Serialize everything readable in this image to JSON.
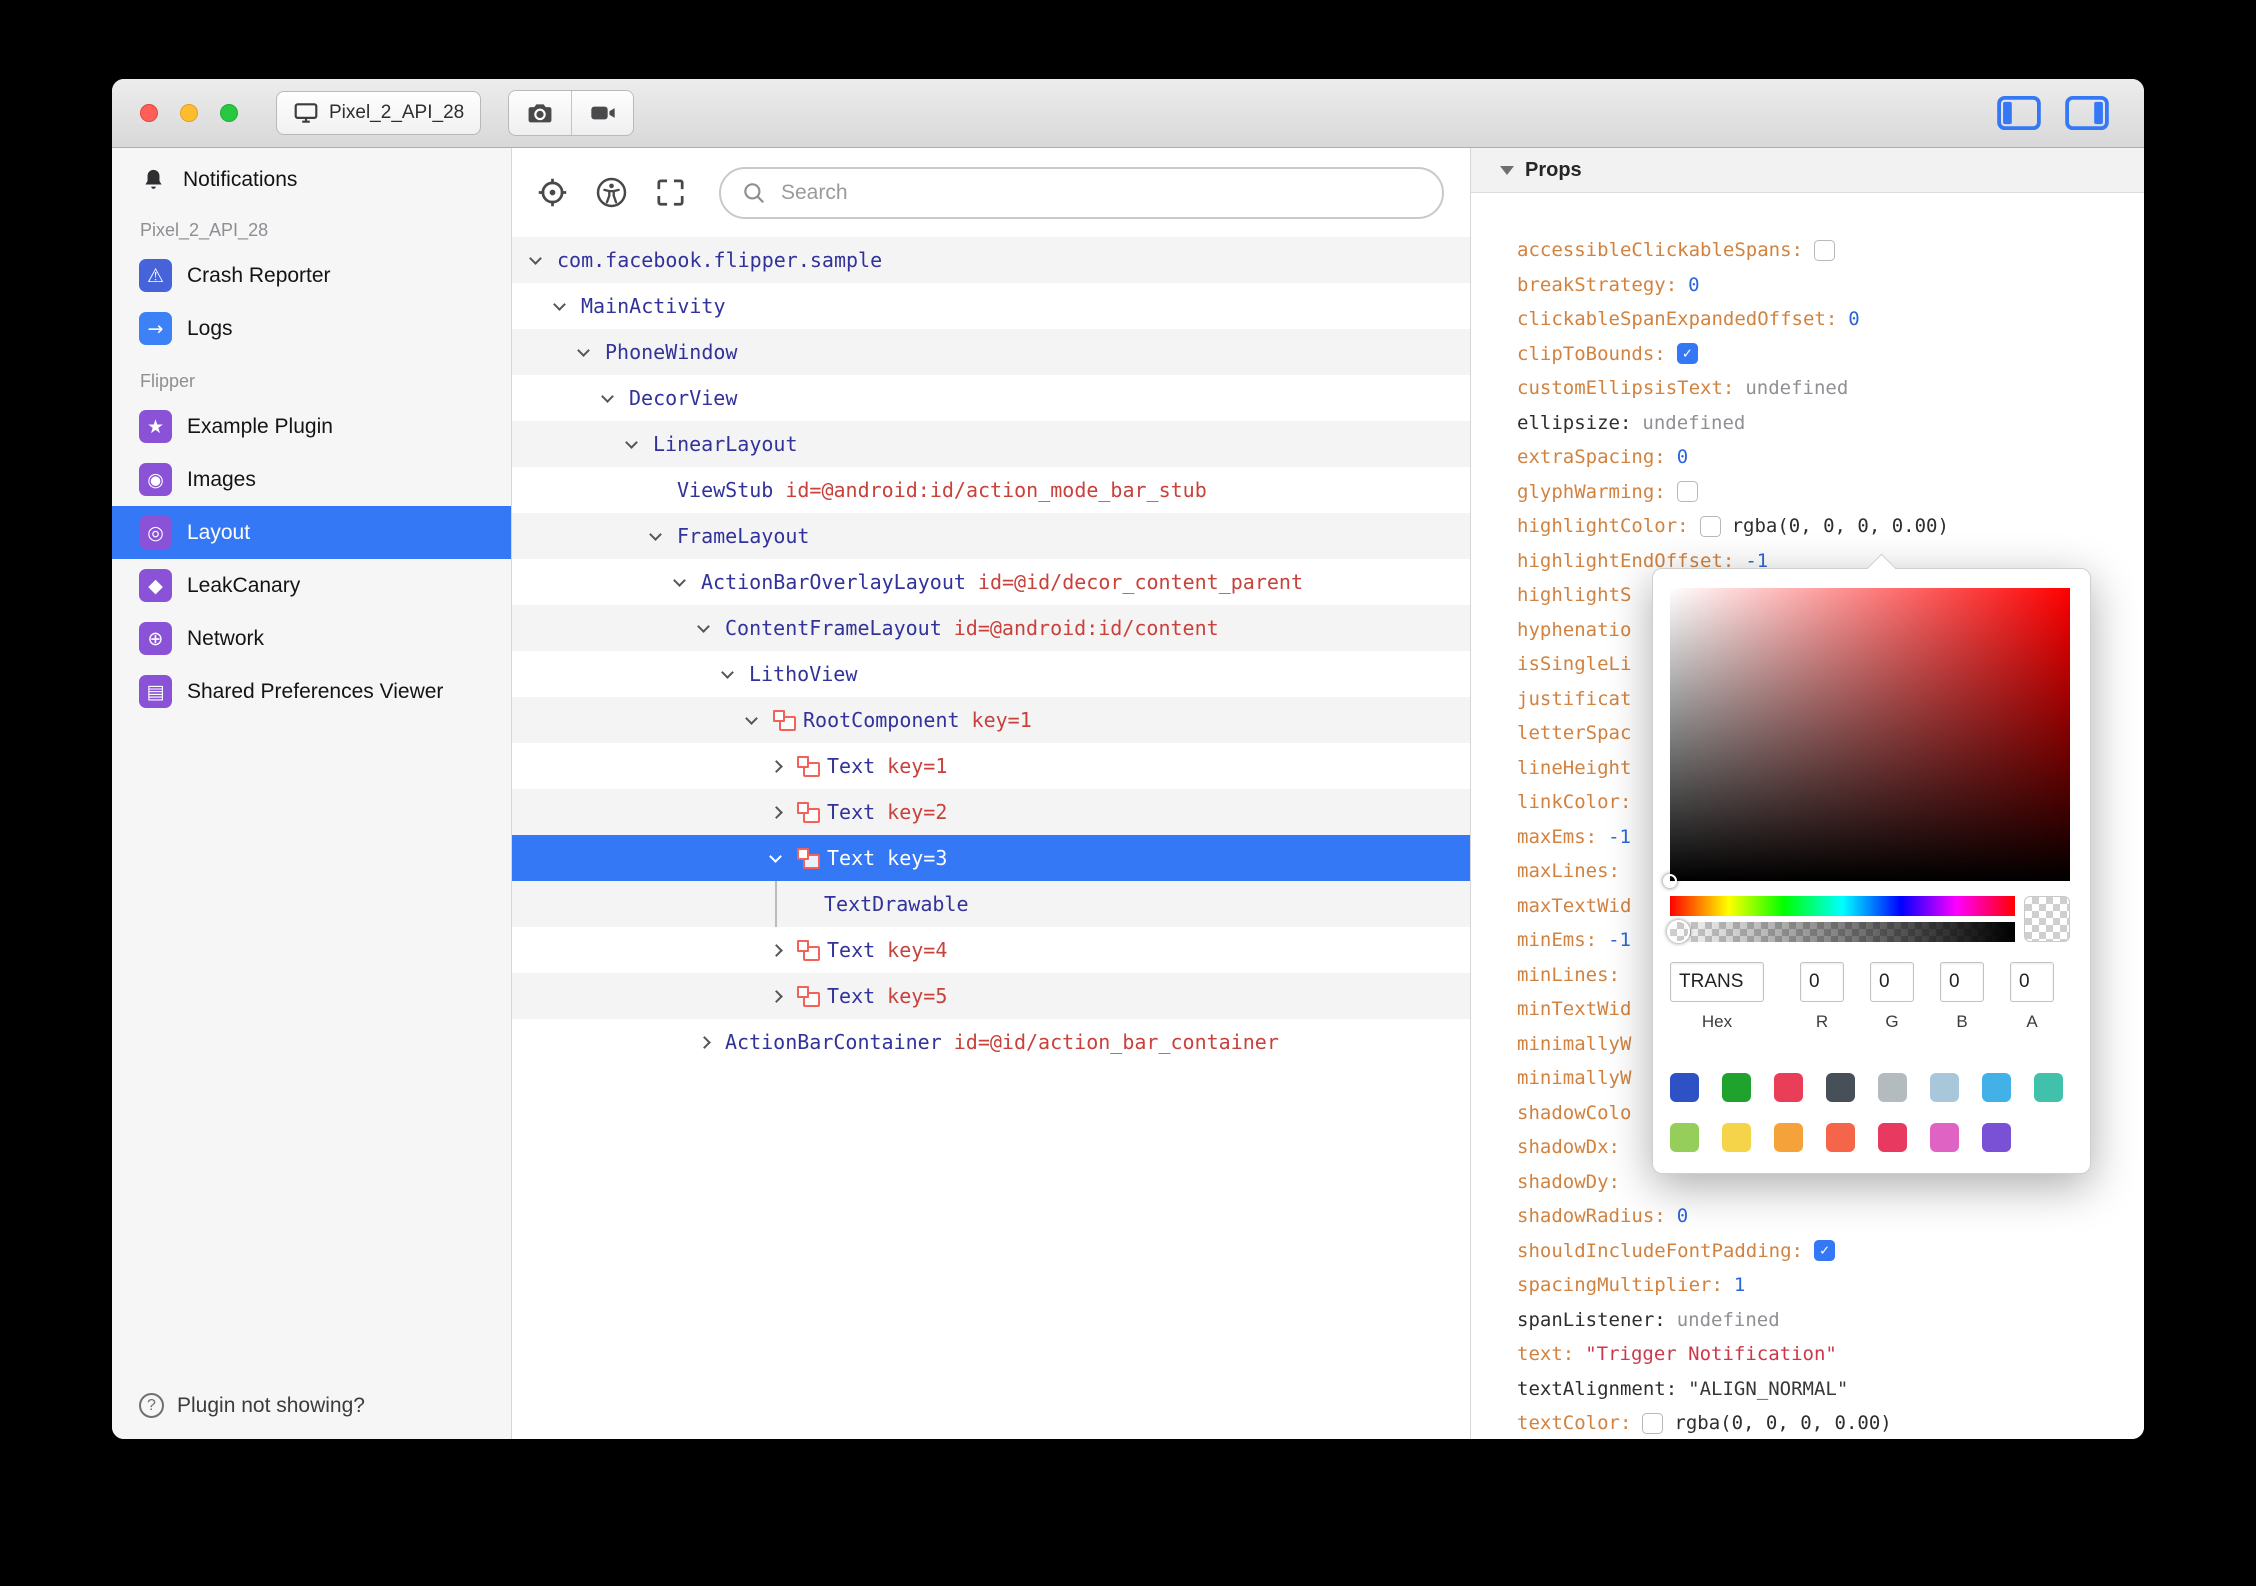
{
  "colors": {
    "selection": "#3478f6",
    "tree_name": "#32329b",
    "tree_attr": "#c8413b",
    "prop_key": "#d1823f",
    "prop_number": "#2b66d9",
    "prop_string": "#cb3849"
  },
  "titlebar": {
    "device_label": "Pixel_2_API_28"
  },
  "sidebar": {
    "notifications_label": "Notifications",
    "sections": [
      {
        "label": "Pixel_2_API_28",
        "items": [
          {
            "label": "Crash Reporter",
            "icon": "crash-reporter-icon",
            "glyph": "⚠",
            "color": "#4663d9"
          },
          {
            "label": "Logs",
            "icon": "logs-icon",
            "glyph": "→",
            "color": "#3c82f6"
          }
        ]
      },
      {
        "label": "Flipper",
        "items": [
          {
            "label": "Example Plugin",
            "icon": "example-plugin-icon",
            "glyph": "★",
            "color": "#8a52d7"
          },
          {
            "label": "Images",
            "icon": "images-icon",
            "glyph": "◉",
            "color": "#8a52d7"
          },
          {
            "label": "Layout",
            "icon": "layout-icon",
            "glyph": "◎",
            "color": "#8a52d7",
            "selected": true
          },
          {
            "label": "LeakCanary",
            "icon": "leakcanary-icon",
            "glyph": "◆",
            "color": "#8a52d7"
          },
          {
            "label": "Network",
            "icon": "network-icon",
            "glyph": "⊕",
            "color": "#8a52d7"
          },
          {
            "label": "Shared Preferences Viewer",
            "icon": "shared-preferences-icon",
            "glyph": "▤",
            "color": "#8a52d7"
          }
        ]
      }
    ],
    "footer_label": "Plugin not showing?"
  },
  "tree": {
    "search_placeholder": "Search",
    "rows": [
      {
        "indent": 0,
        "exp": "down",
        "name": "com.facebook.flipper.sample"
      },
      {
        "indent": 1,
        "exp": "down",
        "name": "MainActivity"
      },
      {
        "indent": 2,
        "exp": "down",
        "name": "PhoneWindow"
      },
      {
        "indent": 3,
        "exp": "down",
        "name": "DecorView"
      },
      {
        "indent": 4,
        "exp": "down",
        "name": "LinearLayout"
      },
      {
        "indent": 5,
        "exp": "none",
        "name": "ViewStub",
        "attr": "id=@android:id/action_mode_bar_stub"
      },
      {
        "indent": 5,
        "exp": "down",
        "name": "FrameLayout"
      },
      {
        "indent": 6,
        "exp": "down",
        "name": "ActionBarOverlayLayout",
        "attr": "id=@id/decor_content_parent"
      },
      {
        "indent": 7,
        "exp": "down",
        "name": "ContentFrameLayout",
        "attr": "id=@android:id/content"
      },
      {
        "indent": 8,
        "exp": "down",
        "name": "LithoView"
      },
      {
        "indent": 9,
        "exp": "down",
        "icon": true,
        "name": "RootComponent",
        "attr": "key=1"
      },
      {
        "indent": 10,
        "exp": "right",
        "icon": true,
        "name": "Text",
        "attr": "key=1"
      },
      {
        "indent": 10,
        "exp": "right",
        "icon": true,
        "name": "Text",
        "attr": "key=2"
      },
      {
        "indent": 10,
        "exp": "down",
        "icon": true,
        "name": "Text",
        "attr": "key=3",
        "selected": true
      },
      {
        "indent": 10,
        "exp": "line",
        "name": "TextDrawable"
      },
      {
        "indent": 10,
        "exp": "right",
        "icon": true,
        "name": "Text",
        "attr": "key=4"
      },
      {
        "indent": 10,
        "exp": "right",
        "icon": true,
        "name": "Text",
        "attr": "key=5"
      },
      {
        "indent": 7,
        "exp": "right",
        "name": "ActionBarContainer",
        "attr": "id=@id/action_bar_container"
      }
    ]
  },
  "props": {
    "header": "Props",
    "rows": [
      {
        "key": "accessibleClickableSpans:",
        "kc": "orange",
        "type": "checkbox",
        "checked": false
      },
      {
        "key": "breakStrategy:",
        "kc": "orange",
        "type": "number",
        "value": "0"
      },
      {
        "key": "clickableSpanExpandedOffset:",
        "kc": "orange",
        "type": "number",
        "value": "0"
      },
      {
        "key": "clipToBounds:",
        "kc": "orange",
        "type": "checkbox",
        "checked": true
      },
      {
        "key": "customEllipsisText:",
        "kc": "orange",
        "type": "undefined",
        "value": "undefined"
      },
      {
        "key": "ellipsize:",
        "kc": "plain",
        "type": "undefined",
        "value": "undefined"
      },
      {
        "key": "extraSpacing:",
        "kc": "orange",
        "type": "number",
        "value": "0"
      },
      {
        "key": "glyphWarming:",
        "kc": "orange",
        "type": "checkbox",
        "checked": false
      },
      {
        "key": "highlightColor:",
        "kc": "orange",
        "type": "color",
        "checked": false,
        "value": "rgba(0, 0, 0, 0.00)"
      },
      {
        "key": "highlightEndOffset:",
        "kc": "orange",
        "type": "number",
        "value": "-1"
      },
      {
        "key": "highlightS",
        "kc": "orange",
        "type": "none"
      },
      {
        "key": "hyphenatio",
        "kc": "orange",
        "type": "none"
      },
      {
        "key": "isSingleLi",
        "kc": "orange",
        "type": "none"
      },
      {
        "key": "justificat",
        "kc": "orange",
        "type": "none"
      },
      {
        "key": "letterSpac",
        "kc": "orange",
        "type": "none"
      },
      {
        "key": "lineHeight",
        "kc": "orange",
        "type": "none"
      },
      {
        "key": "linkColor:",
        "kc": "orange",
        "type": "none"
      },
      {
        "key": "maxEms:",
        "kc": "orange",
        "type": "number",
        "value": "-1"
      },
      {
        "key": "maxLines:",
        "kc": "orange",
        "type": "none"
      },
      {
        "key": "maxTextWid",
        "kc": "orange",
        "type": "none"
      },
      {
        "key": "minEms:",
        "kc": "orange",
        "type": "number",
        "value": "-1"
      },
      {
        "key": "minLines:",
        "kc": "orange",
        "type": "none"
      },
      {
        "key": "minTextWid",
        "kc": "orange",
        "type": "none"
      },
      {
        "key": "minimallyW",
        "kc": "orange",
        "type": "none"
      },
      {
        "key": "minimallyW",
        "kc": "orange",
        "type": "none"
      },
      {
        "key": "shadowColo",
        "kc": "orange",
        "type": "none"
      },
      {
        "key": "shadowDx:",
        "kc": "orange",
        "type": "none"
      },
      {
        "key": "shadowDy:",
        "kc": "orange",
        "type": "none"
      },
      {
        "key": "shadowRadius:",
        "kc": "orange",
        "type": "number",
        "value": "0"
      },
      {
        "key": "shouldIncludeFontPadding:",
        "kc": "orange",
        "type": "checkbox",
        "checked": true
      },
      {
        "key": "spacingMultiplier:",
        "kc": "orange",
        "type": "number",
        "value": "1"
      },
      {
        "key": "spanListener:",
        "kc": "plain",
        "type": "undefined",
        "value": "undefined"
      },
      {
        "key": "text:",
        "kc": "orange",
        "type": "string",
        "value": "\"Trigger Notification\""
      },
      {
        "key": "textAlignment:",
        "kc": "plain",
        "type": "quoted",
        "value": "\"ALIGN_NORMAL\""
      },
      {
        "key": "textColor:",
        "kc": "orange",
        "type": "color",
        "checked": false,
        "value": "rgba(0, 0, 0, 0.00)"
      }
    ]
  },
  "color_picker": {
    "hex_value": "TRANS",
    "r_value": "0",
    "g_value": "0",
    "b_value": "0",
    "a_value": "0",
    "labels": {
      "hex": "Hex",
      "r": "R",
      "g": "G",
      "b": "B",
      "a": "A"
    },
    "presets_row1": [
      "#2e52c6",
      "#1fa32e",
      "#ea3e58",
      "#474f59",
      "#b4bbbe",
      "#a9c7da",
      "#41b1e8",
      "#41c0ab"
    ],
    "presets_row2": [
      "#95ce5a",
      "#f6d44a",
      "#f6a23a",
      "#f5654a",
      "#e83a60",
      "#df63c3",
      "#7a50d4"
    ]
  }
}
